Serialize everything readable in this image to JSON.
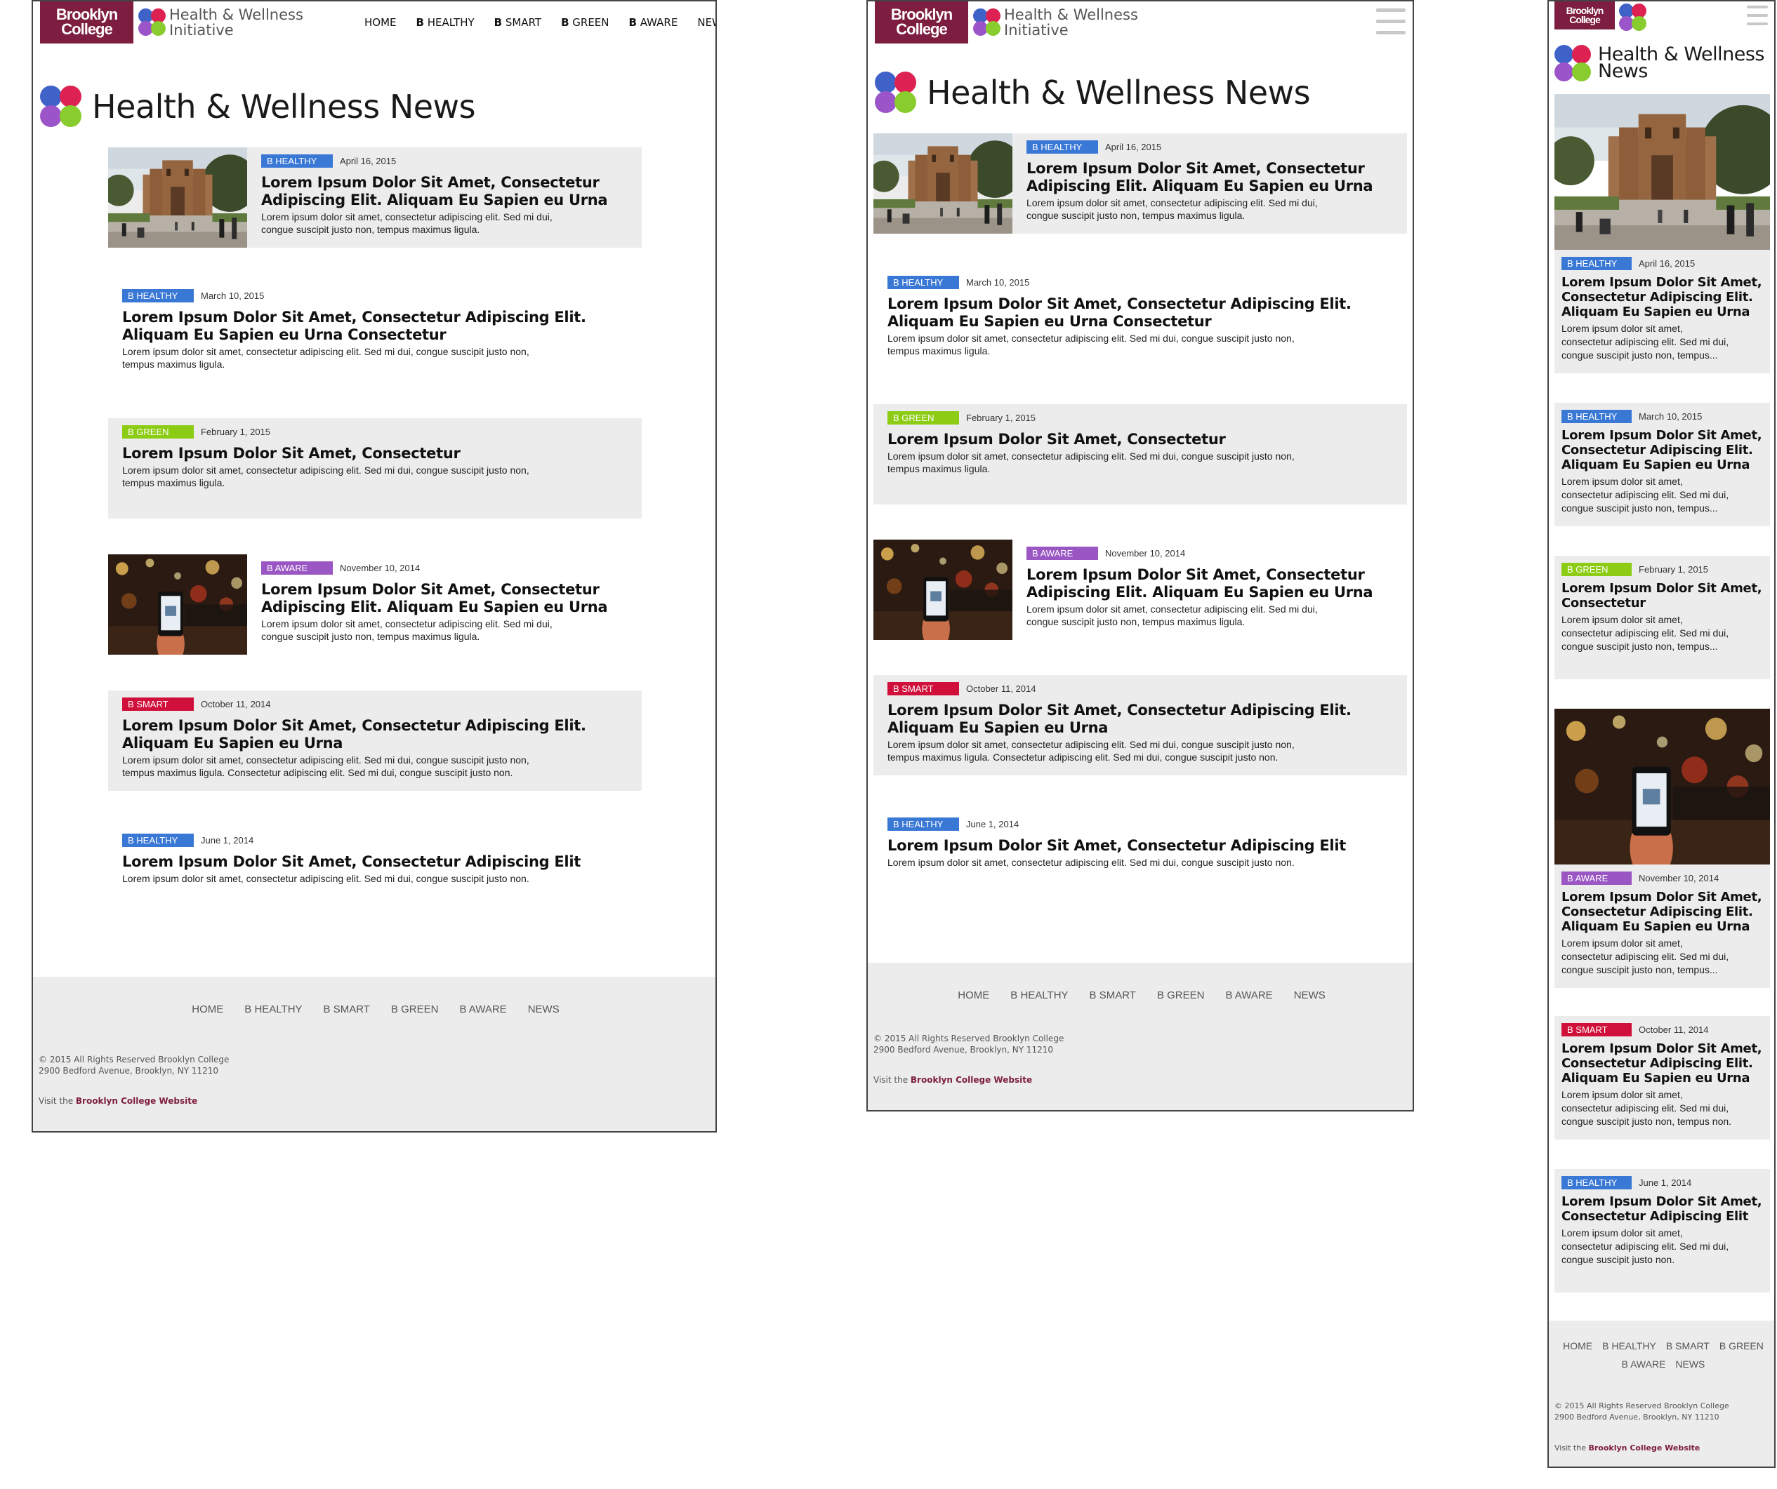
{
  "brand": {
    "college_line1": "Brooklyn",
    "college_line2": "College",
    "initiative_line1": "Health & Wellness",
    "initiative_line2": "Initiative"
  },
  "nav": [
    {
      "prefix": "",
      "label": "HOME"
    },
    {
      "prefix": "B",
      "label": " HEALTHY"
    },
    {
      "prefix": "B",
      "label": " SMART"
    },
    {
      "prefix": "B",
      "label": " GREEN"
    },
    {
      "prefix": "B",
      "label": " AWARE"
    },
    {
      "prefix": "",
      "label": "NEWS"
    }
  ],
  "page": {
    "title": "Health & Wellness News",
    "mobile_title_line1": "Health & Wellness",
    "mobile_title_line2": "News"
  },
  "tags": {
    "healthy": {
      "label": "B HEALTHY",
      "color": "#3a78d6"
    },
    "green": {
      "label": "B GREEN",
      "color": "#8ccc14"
    },
    "aware": {
      "label": "B AWARE",
      "color": "#9a56c2"
    },
    "smart": {
      "label": "B SMART",
      "color": "#d0103a"
    }
  },
  "articles": [
    {
      "tag": "B HEALTHY",
      "date": "April 16, 2015",
      "title_l1": "Lorem Ipsum Dolor Sit Amet, Consectetur",
      "title_l2": "Adipiscing Elit. Aliquam Eu Sapien eu Urna",
      "body_l1": "Lorem ipsum dolor sit amet, consectetur adipiscing elit. Sed mi dui,",
      "body_l2": "congue suscipit justo non, tempus maximus ligula."
    },
    {
      "tag": "B HEALTHY",
      "date": "March 10, 2015",
      "title_l1": "Lorem Ipsum Dolor Sit Amet, Consectetur Adipiscing Elit.",
      "title_l2": "Aliquam Eu Sapien eu Urna Consectetur",
      "body_l1": "Lorem ipsum dolor sit amet, consectetur adipiscing elit. Sed mi dui, congue suscipit justo non,",
      "body_l2": "tempus maximus ligula."
    },
    {
      "tag": "B GREEN",
      "date": "February 1, 2015",
      "title_l1": "Lorem Ipsum Dolor Sit Amet, Consectetur",
      "body_l1": "Lorem ipsum dolor sit amet, consectetur adipiscing elit. Sed mi dui, congue suscipit justo non,",
      "body_l2": "tempus maximus ligula."
    },
    {
      "tag": "B AWARE",
      "date": "November 10, 2014",
      "title_l1": "Lorem Ipsum Dolor Sit Amet, Consectetur",
      "title_l2": "Adipiscing Elit. Aliquam Eu Sapien eu Urna",
      "body_l1": "Lorem ipsum dolor sit amet, consectetur adipiscing elit. Sed mi dui,",
      "body_l2": "congue suscipit justo non, tempus maximus ligula."
    },
    {
      "tag": "B SMART",
      "date": "October 11, 2014",
      "title_l1": "Lorem Ipsum Dolor Sit Amet, Consectetur Adipiscing Elit.",
      "title_l2": "Aliquam Eu Sapien eu Urna",
      "body_l1": "Lorem ipsum dolor sit amet, consectetur adipiscing elit. Sed mi dui, congue suscipit justo non,",
      "body_l2": "tempus maximus ligula. Consectetur adipiscing elit. Sed mi dui, congue suscipit justo non."
    },
    {
      "tag": "B HEALTHY",
      "date": "June 1, 2014",
      "title_l1": "Lorem Ipsum Dolor Sit Amet, Consectetur Adipiscing Elit",
      "body_l1": "Lorem ipsum dolor sit amet, consectetur adipiscing elit. Sed mi dui, congue suscipit justo non."
    }
  ],
  "mobile_articles": [
    {
      "tag": "B HEALTHY",
      "date": "April 16, 2015",
      "title": [
        "Lorem Ipsum Dolor Sit Amet,",
        "Consectetur Adipiscing Elit.",
        "Aliquam Eu Sapien eu Urna"
      ],
      "body": [
        "Lorem ipsum dolor sit amet,",
        "consectetur adipiscing elit. Sed mi dui,",
        "congue suscipit justo non, tempus..."
      ]
    },
    {
      "tag": "B HEALTHY",
      "date": "March 10, 2015",
      "title": [
        "Lorem Ipsum Dolor Sit Amet,",
        "Consectetur Adipiscing Elit.",
        "Aliquam Eu Sapien eu Urna"
      ],
      "body": [
        "Lorem ipsum dolor sit amet,",
        "consectetur adipiscing elit. Sed mi dui,",
        "congue suscipit justo non, tempus..."
      ]
    },
    {
      "tag": "B GREEN",
      "date": "February 1, 2015",
      "title": [
        "Lorem Ipsum Dolor Sit Amet,",
        "Consectetur"
      ],
      "body": [
        "Lorem ipsum dolor sit amet,",
        "consectetur adipiscing elit. Sed mi dui,",
        "congue suscipit justo non, tempus..."
      ]
    },
    {
      "tag": "B AWARE",
      "date": "November 10, 2014",
      "title": [
        "Lorem Ipsum Dolor Sit Amet,",
        "Consectetur Adipiscing Elit.",
        "Aliquam Eu Sapien eu Urna"
      ],
      "body": [
        "Lorem ipsum dolor sit amet,",
        "consectetur adipiscing elit. Sed mi dui,",
        "congue suscipit justo non, tempus..."
      ]
    },
    {
      "tag": "B SMART",
      "date": "October 11, 2014",
      "title": [
        "Lorem Ipsum Dolor Sit Amet,",
        "Consectetur Adipiscing Elit.",
        "Aliquam Eu Sapien eu Urna"
      ],
      "body": [
        "Lorem ipsum dolor sit amet,",
        "consectetur adipiscing elit. Sed mi dui,",
        "congue suscipit justo non, tempus non."
      ]
    },
    {
      "tag": "B HEALTHY",
      "date": "June 1, 2014",
      "title": [
        "Lorem Ipsum Dolor Sit Amet,",
        "Consectetur Adipiscing Elit"
      ],
      "body": [
        "Lorem ipsum dolor sit amet,",
        "consectetur adipiscing elit. Sed mi dui,",
        "congue suscipit justo non."
      ]
    }
  ],
  "footer": {
    "nav": [
      "HOME",
      "B HEALTHY",
      "B SMART",
      "B GREEN",
      "B AWARE",
      "NEWS"
    ],
    "copyright_l1": "© 2015 All Rights Reserved Brooklyn College",
    "copyright_l2": "2900 Bedford Avenue, Brooklyn, NY 11210",
    "visit_prefix": "Visit the ",
    "visit_link": "Brooklyn College Website"
  },
  "icons": [
    "hamburger-menu-icon",
    "logo-dots-icon",
    "campus-photo",
    "night-street-phone-photo"
  ]
}
